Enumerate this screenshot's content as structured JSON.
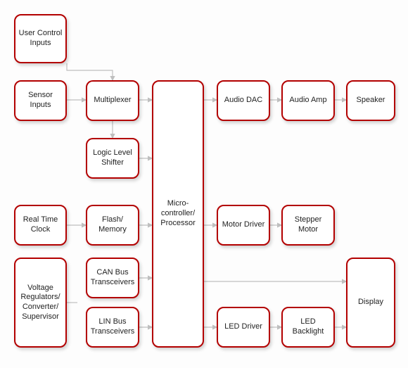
{
  "diagram": {
    "nodes": {
      "user_inputs": "User Control Inputs",
      "sensor_inputs": "Sensor Inputs",
      "multiplexer": "Multiplexer",
      "level_shifter": "Logic Level Shifter",
      "rtc": "Real Time Clock",
      "flash": "Flash/ Memory",
      "can": "CAN Bus Transceivers",
      "lin": "LIN Bus Transceivers",
      "vreg": "Voltage Regulators/ Converter/ Supervisor",
      "mcu": "Micro-controller/ Processor",
      "audio_dac": "Audio DAC",
      "audio_amp": "Audio Amp",
      "speaker": "Speaker",
      "motor_driver": "Motor Driver",
      "stepper": "Stepper Motor",
      "led_driver": "LED Driver",
      "led_backlight": "LED Backlight",
      "display": "Display"
    }
  }
}
